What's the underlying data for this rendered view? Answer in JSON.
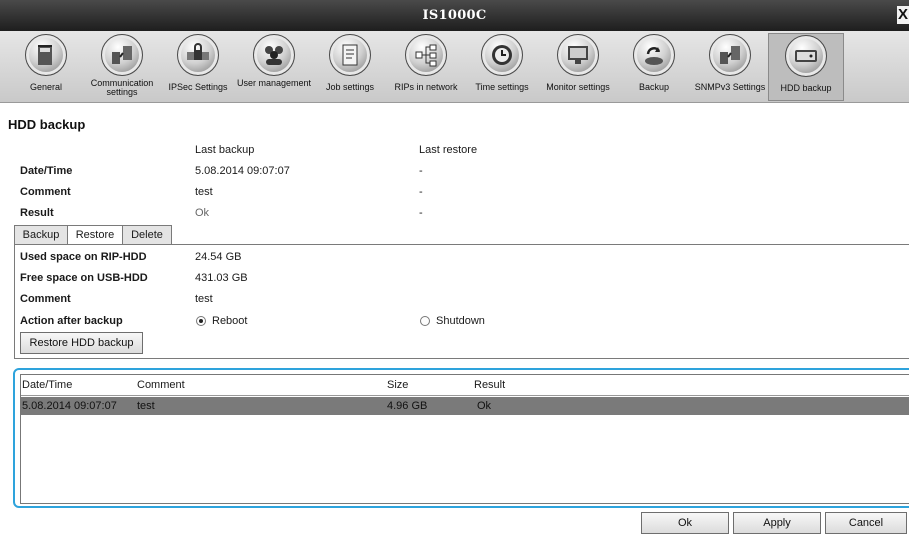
{
  "window": {
    "title": "IS1000C",
    "close_label": "X"
  },
  "toolbar": [
    {
      "label": "General",
      "icon": "server-icon"
    },
    {
      "label": "Communication settings",
      "icon": "network-icon"
    },
    {
      "label": "IPSec Settings",
      "icon": "lock-icon"
    },
    {
      "label": "User management",
      "icon": "users-icon"
    },
    {
      "label": "Job settings",
      "icon": "document-icon"
    },
    {
      "label": "RIPs in network",
      "icon": "tree-icon"
    },
    {
      "label": "Time settings",
      "icon": "clock-icon"
    },
    {
      "label": "Monitor settings",
      "icon": "monitor-icon"
    },
    {
      "label": "Backup",
      "icon": "backup-icon"
    },
    {
      "label": "SNMPv3 Settings",
      "icon": "network-icon"
    },
    {
      "label": "HDD backup",
      "icon": "hdd-icon",
      "active": true
    }
  ],
  "page_title": "HDD backup",
  "summary": {
    "col_last_backup": "Last backup",
    "col_last_restore": "Last restore",
    "rows": [
      {
        "label": "Date/Time",
        "backup": "5.08.2014 09:07:07",
        "restore": "-"
      },
      {
        "label": "Comment",
        "backup": "test",
        "restore": "-"
      },
      {
        "label": "Result",
        "backup": "Ok",
        "restore": "-"
      }
    ]
  },
  "tabs": [
    "Backup",
    "Restore",
    "Delete"
  ],
  "active_tab": "Restore",
  "restore": {
    "used_label": "Used space on RIP-HDD",
    "used_value": "24.54 GB",
    "free_label": "Free space on USB-HDD",
    "free_value": "431.03 GB",
    "comment_label": "Comment",
    "comment_value": "test",
    "action_label": "Action after backup",
    "options": [
      "Reboot",
      "Shutdown"
    ],
    "selected_option": "Reboot",
    "restore_button": "Restore HDD backup"
  },
  "backups_table": {
    "columns": [
      "Date/Time",
      "Comment",
      "Size",
      "Result"
    ],
    "rows": [
      [
        "5.08.2014 09:07:07",
        "test",
        "4.96 GB",
        "Ok"
      ]
    ],
    "selected_row": 0
  },
  "footer": {
    "ok": "Ok",
    "apply": "Apply",
    "cancel": "Cancel"
  },
  "colors": {
    "titlebar": "#2a2a2a",
    "selection": "#7a7a7a",
    "focus_border": "#2ea3dc"
  }
}
